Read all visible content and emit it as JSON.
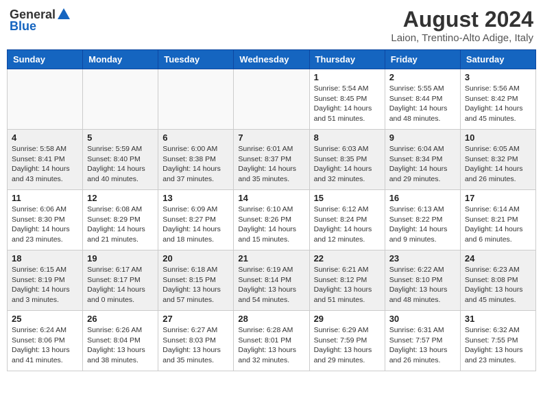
{
  "header": {
    "logo_general": "General",
    "logo_blue": "Blue",
    "month_year": "August 2024",
    "location": "Laion, Trentino-Alto Adige, Italy"
  },
  "days_of_week": [
    "Sunday",
    "Monday",
    "Tuesday",
    "Wednesday",
    "Thursday",
    "Friday",
    "Saturday"
  ],
  "weeks": [
    [
      {
        "day": "",
        "detail": ""
      },
      {
        "day": "",
        "detail": ""
      },
      {
        "day": "",
        "detail": ""
      },
      {
        "day": "",
        "detail": ""
      },
      {
        "day": "1",
        "detail": "Sunrise: 5:54 AM\nSunset: 8:45 PM\nDaylight: 14 hours\nand 51 minutes."
      },
      {
        "day": "2",
        "detail": "Sunrise: 5:55 AM\nSunset: 8:44 PM\nDaylight: 14 hours\nand 48 minutes."
      },
      {
        "day": "3",
        "detail": "Sunrise: 5:56 AM\nSunset: 8:42 PM\nDaylight: 14 hours\nand 45 minutes."
      }
    ],
    [
      {
        "day": "4",
        "detail": "Sunrise: 5:58 AM\nSunset: 8:41 PM\nDaylight: 14 hours\nand 43 minutes."
      },
      {
        "day": "5",
        "detail": "Sunrise: 5:59 AM\nSunset: 8:40 PM\nDaylight: 14 hours\nand 40 minutes."
      },
      {
        "day": "6",
        "detail": "Sunrise: 6:00 AM\nSunset: 8:38 PM\nDaylight: 14 hours\nand 37 minutes."
      },
      {
        "day": "7",
        "detail": "Sunrise: 6:01 AM\nSunset: 8:37 PM\nDaylight: 14 hours\nand 35 minutes."
      },
      {
        "day": "8",
        "detail": "Sunrise: 6:03 AM\nSunset: 8:35 PM\nDaylight: 14 hours\nand 32 minutes."
      },
      {
        "day": "9",
        "detail": "Sunrise: 6:04 AM\nSunset: 8:34 PM\nDaylight: 14 hours\nand 29 minutes."
      },
      {
        "day": "10",
        "detail": "Sunrise: 6:05 AM\nSunset: 8:32 PM\nDaylight: 14 hours\nand 26 minutes."
      }
    ],
    [
      {
        "day": "11",
        "detail": "Sunrise: 6:06 AM\nSunset: 8:30 PM\nDaylight: 14 hours\nand 23 minutes."
      },
      {
        "day": "12",
        "detail": "Sunrise: 6:08 AM\nSunset: 8:29 PM\nDaylight: 14 hours\nand 21 minutes."
      },
      {
        "day": "13",
        "detail": "Sunrise: 6:09 AM\nSunset: 8:27 PM\nDaylight: 14 hours\nand 18 minutes."
      },
      {
        "day": "14",
        "detail": "Sunrise: 6:10 AM\nSunset: 8:26 PM\nDaylight: 14 hours\nand 15 minutes."
      },
      {
        "day": "15",
        "detail": "Sunrise: 6:12 AM\nSunset: 8:24 PM\nDaylight: 14 hours\nand 12 minutes."
      },
      {
        "day": "16",
        "detail": "Sunrise: 6:13 AM\nSunset: 8:22 PM\nDaylight: 14 hours\nand 9 minutes."
      },
      {
        "day": "17",
        "detail": "Sunrise: 6:14 AM\nSunset: 8:21 PM\nDaylight: 14 hours\nand 6 minutes."
      }
    ],
    [
      {
        "day": "18",
        "detail": "Sunrise: 6:15 AM\nSunset: 8:19 PM\nDaylight: 14 hours\nand 3 minutes."
      },
      {
        "day": "19",
        "detail": "Sunrise: 6:17 AM\nSunset: 8:17 PM\nDaylight: 14 hours\nand 0 minutes."
      },
      {
        "day": "20",
        "detail": "Sunrise: 6:18 AM\nSunset: 8:15 PM\nDaylight: 13 hours\nand 57 minutes."
      },
      {
        "day": "21",
        "detail": "Sunrise: 6:19 AM\nSunset: 8:14 PM\nDaylight: 13 hours\nand 54 minutes."
      },
      {
        "day": "22",
        "detail": "Sunrise: 6:21 AM\nSunset: 8:12 PM\nDaylight: 13 hours\nand 51 minutes."
      },
      {
        "day": "23",
        "detail": "Sunrise: 6:22 AM\nSunset: 8:10 PM\nDaylight: 13 hours\nand 48 minutes."
      },
      {
        "day": "24",
        "detail": "Sunrise: 6:23 AM\nSunset: 8:08 PM\nDaylight: 13 hours\nand 45 minutes."
      }
    ],
    [
      {
        "day": "25",
        "detail": "Sunrise: 6:24 AM\nSunset: 8:06 PM\nDaylight: 13 hours\nand 41 minutes."
      },
      {
        "day": "26",
        "detail": "Sunrise: 6:26 AM\nSunset: 8:04 PM\nDaylight: 13 hours\nand 38 minutes."
      },
      {
        "day": "27",
        "detail": "Sunrise: 6:27 AM\nSunset: 8:03 PM\nDaylight: 13 hours\nand 35 minutes."
      },
      {
        "day": "28",
        "detail": "Sunrise: 6:28 AM\nSunset: 8:01 PM\nDaylight: 13 hours\nand 32 minutes."
      },
      {
        "day": "29",
        "detail": "Sunrise: 6:29 AM\nSunset: 7:59 PM\nDaylight: 13 hours\nand 29 minutes."
      },
      {
        "day": "30",
        "detail": "Sunrise: 6:31 AM\nSunset: 7:57 PM\nDaylight: 13 hours\nand 26 minutes."
      },
      {
        "day": "31",
        "detail": "Sunrise: 6:32 AM\nSunset: 7:55 PM\nDaylight: 13 hours\nand 23 minutes."
      }
    ]
  ]
}
